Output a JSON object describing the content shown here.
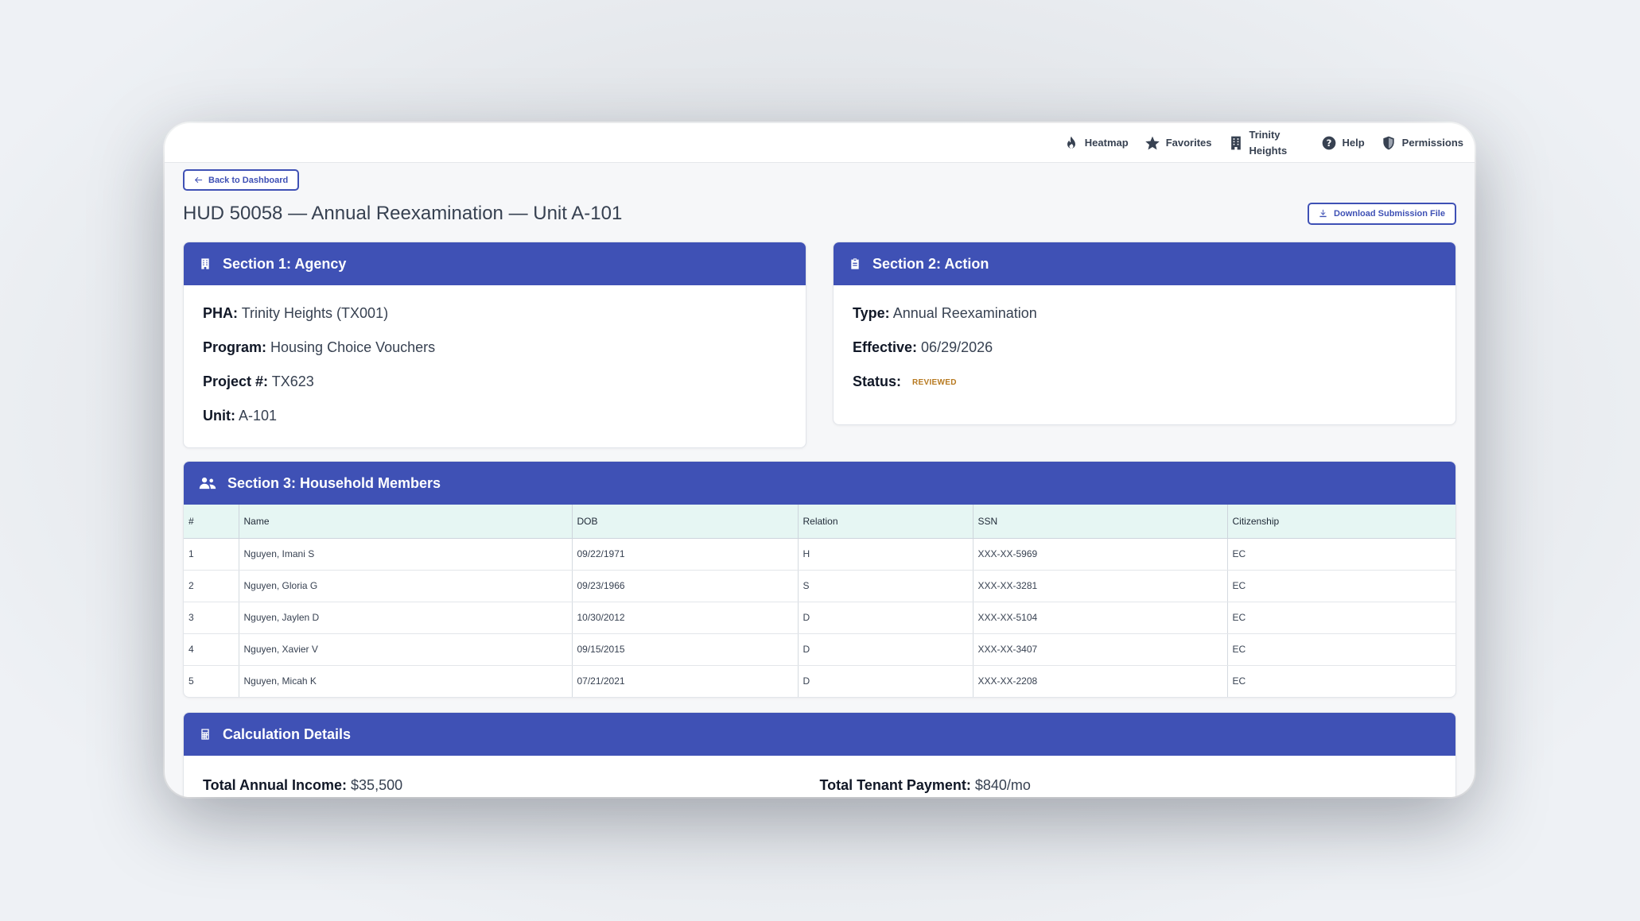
{
  "nav": {
    "heatmap": "Heatmap",
    "favorites": "Favorites",
    "property": "Trinity Heights",
    "help": "Help",
    "permissions": "Permissions"
  },
  "back_button": "Back to Dashboard",
  "page_title": "HUD 50058 — Annual Reexamination — Unit A-101",
  "download_button": "Download Submission File",
  "section1": {
    "title": "Section 1: Agency",
    "pha_label": "PHA:",
    "pha_value": "Trinity Heights (TX001)",
    "program_label": "Program:",
    "program_value": "Housing Choice Vouchers",
    "project_label": "Project #:",
    "project_value": "TX623",
    "unit_label": "Unit:",
    "unit_value": "A-101"
  },
  "section2": {
    "title": "Section 2: Action",
    "type_label": "Type:",
    "type_value": "Annual Reexamination",
    "effective_label": "Effective:",
    "effective_value": "06/29/2026",
    "status_label": "Status:",
    "status_value": "REVIEWED",
    "status_color": "#b7791f"
  },
  "section3": {
    "title": "Section 3: Household Members",
    "columns": [
      "#",
      "Name",
      "DOB",
      "Relation",
      "SSN",
      "Citizenship"
    ],
    "rows": [
      [
        "1",
        "Nguyen, Imani S",
        "09/22/1971",
        "H",
        "XXX-XX-5969",
        "EC"
      ],
      [
        "2",
        "Nguyen, Gloria G",
        "09/23/1966",
        "S",
        "XXX-XX-3281",
        "EC"
      ],
      [
        "3",
        "Nguyen, Jaylen D",
        "10/30/2012",
        "D",
        "XXX-XX-5104",
        "EC"
      ],
      [
        "4",
        "Nguyen, Xavier V",
        "09/15/2015",
        "D",
        "XXX-XX-3407",
        "EC"
      ],
      [
        "5",
        "Nguyen, Micah K",
        "07/21/2021",
        "D",
        "XXX-XX-2208",
        "EC"
      ]
    ]
  },
  "calc": {
    "title": "Calculation Details",
    "income_label": "Total Annual Income:",
    "income_value": "$35,500",
    "ttp_label": "Total Tenant Payment:",
    "ttp_value": "$840/mo"
  },
  "colors": {
    "accent": "#3f51b5",
    "table_header_bg": "#e6f6f3"
  }
}
